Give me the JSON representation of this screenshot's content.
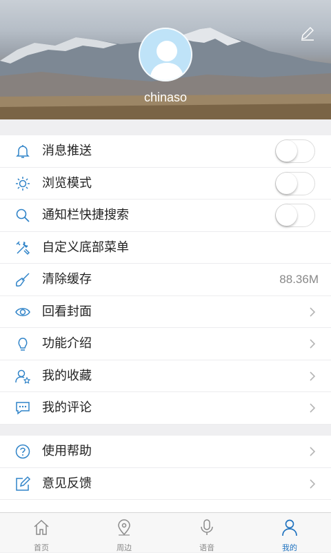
{
  "profile": {
    "username": "chinaso"
  },
  "settings_group1": [
    {
      "label": "消息推送",
      "icon": "bell-icon",
      "control": "toggle",
      "on": false
    },
    {
      "label": "浏览模式",
      "icon": "sun-icon",
      "control": "toggle",
      "on": false
    },
    {
      "label": "通知栏快捷搜索",
      "icon": "search-icon",
      "control": "toggle",
      "on": false
    },
    {
      "label": "自定义底部菜单",
      "icon": "tools-icon",
      "control": "none"
    },
    {
      "label": "清除缓存",
      "icon": "broom-icon",
      "control": "value",
      "value": "88.36M"
    },
    {
      "label": "回看封面",
      "icon": "eye-icon",
      "control": "chevron"
    },
    {
      "label": "功能介绍",
      "icon": "lightbulb-icon",
      "control": "chevron"
    },
    {
      "label": "我的收藏",
      "icon": "user-star-icon",
      "control": "chevron"
    },
    {
      "label": "我的评论",
      "icon": "comment-icon",
      "control": "chevron"
    }
  ],
  "settings_group2": [
    {
      "label": "使用帮助",
      "icon": "help-icon",
      "control": "chevron"
    },
    {
      "label": "意见反馈",
      "icon": "feedback-icon",
      "control": "chevron"
    }
  ],
  "tabbar": {
    "items": [
      {
        "label": "首页",
        "icon": "home-icon"
      },
      {
        "label": "周边",
        "icon": "location-icon"
      },
      {
        "label": "语音",
        "icon": "microphone-icon"
      },
      {
        "label": "我的",
        "icon": "user-icon",
        "active": true
      }
    ]
  },
  "colors": {
    "accent": "#1f72bf",
    "icon_blue": "#2f83c8",
    "tab_inactive": "#888888"
  }
}
